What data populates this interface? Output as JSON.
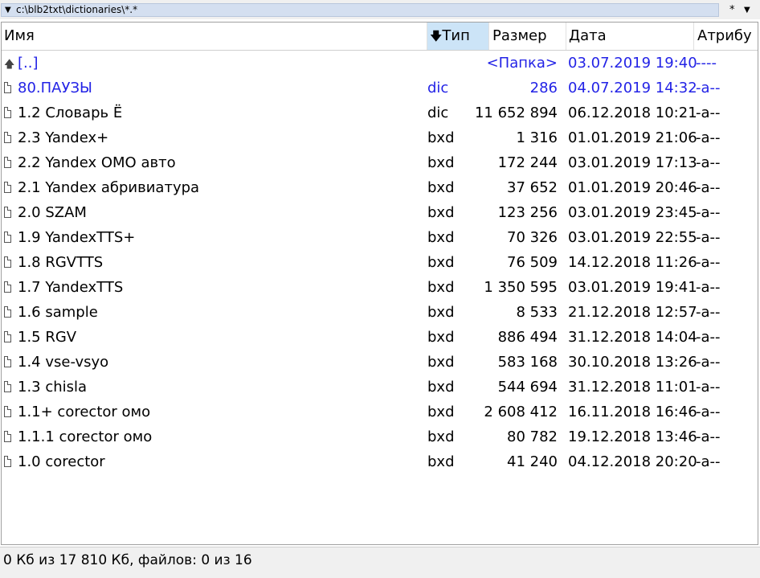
{
  "pathbar": {
    "path": "c:\\blb2txt\\dictionaries\\*.*",
    "filter": "*"
  },
  "columns": {
    "name": "Имя",
    "type": "Тип",
    "size": "Размер",
    "date": "Дата",
    "attr": "Атрибу"
  },
  "rows": [
    {
      "kind": "up",
      "name": "[..]",
      "type": "",
      "size": "<Папка>",
      "date": "03.07.2019 19:40",
      "attr": "----"
    },
    {
      "kind": "hl",
      "name": "80.ПАУЗЫ",
      "type": "dic",
      "size": "286",
      "date": "04.07.2019 14:32",
      "attr": "-a--"
    },
    {
      "kind": "file",
      "name": "1.2 Словарь Ё",
      "type": "dic",
      "size": "11 652 894",
      "date": "06.12.2018 10:21",
      "attr": "-a--"
    },
    {
      "kind": "file",
      "name": "2.3 Yandex+",
      "type": "bxd",
      "size": "1 316",
      "date": "01.01.2019 21:06",
      "attr": "-a--"
    },
    {
      "kind": "file",
      "name": "2.2  Yandex OMO авто",
      "type": "bxd",
      "size": "172 244",
      "date": "03.01.2019 17:13",
      "attr": "-a--"
    },
    {
      "kind": "file",
      "name": "2.1 Yandex абривиатура",
      "type": "bxd",
      "size": "37 652",
      "date": "01.01.2019 20:46",
      "attr": "-a--"
    },
    {
      "kind": "file",
      "name": "2.0 SZAM",
      "type": "bxd",
      "size": "123 256",
      "date": "03.01.2019 23:45",
      "attr": "-a--"
    },
    {
      "kind": "file",
      "name": "1.9 YandexTTS+",
      "type": "bxd",
      "size": "70 326",
      "date": "03.01.2019 22:55",
      "attr": "-a--"
    },
    {
      "kind": "file",
      "name": "1.8 RGVTTS",
      "type": "bxd",
      "size": "76 509",
      "date": "14.12.2018 11:26",
      "attr": "-a--"
    },
    {
      "kind": "file",
      "name": "1.7 YandexTTS",
      "type": "bxd",
      "size": "1 350 595",
      "date": "03.01.2019 19:41",
      "attr": "-a--"
    },
    {
      "kind": "file",
      "name": "1.6 sample",
      "type": "bxd",
      "size": "8 533",
      "date": "21.12.2018 12:57",
      "attr": "-a--"
    },
    {
      "kind": "file",
      "name": "1.5 RGV",
      "type": "bxd",
      "size": "886 494",
      "date": "31.12.2018 14:04",
      "attr": "-a--"
    },
    {
      "kind": "file",
      "name": "1.4 vse-vsyo",
      "type": "bxd",
      "size": "583 168",
      "date": "30.10.2018 13:26",
      "attr": "-a--"
    },
    {
      "kind": "file",
      "name": "1.3 chisla",
      "type": "bxd",
      "size": "544 694",
      "date": "31.12.2018 11:01",
      "attr": "-a--"
    },
    {
      "kind": "file",
      "name": "1.1+ corector омо",
      "type": "bxd",
      "size": "2 608 412",
      "date": "16.11.2018 16:46",
      "attr": "-a--"
    },
    {
      "kind": "file",
      "name": "1.1.1 corector омо",
      "type": "bxd",
      "size": "80 782",
      "date": "19.12.2018 13:46",
      "attr": "-a--"
    },
    {
      "kind": "file",
      "name": "1.0 corector",
      "type": "bxd",
      "size": "41 240",
      "date": "04.12.2018 20:20",
      "attr": "-a--"
    }
  ],
  "status": {
    "text": "0 Кб из 17 810 Кб, файлов: 0 из 16"
  },
  "colors": {
    "link": "#2323e6",
    "sorted_header": "#cce4f7",
    "path_field": "#d4dff0"
  },
  "icons": {
    "path_dropdown": "triangle-down-icon",
    "filter_dropdown": "triangle-down-icon",
    "up_dir": "up-folder-icon",
    "file": "file-icon",
    "sort": "arrow-down-icon"
  }
}
